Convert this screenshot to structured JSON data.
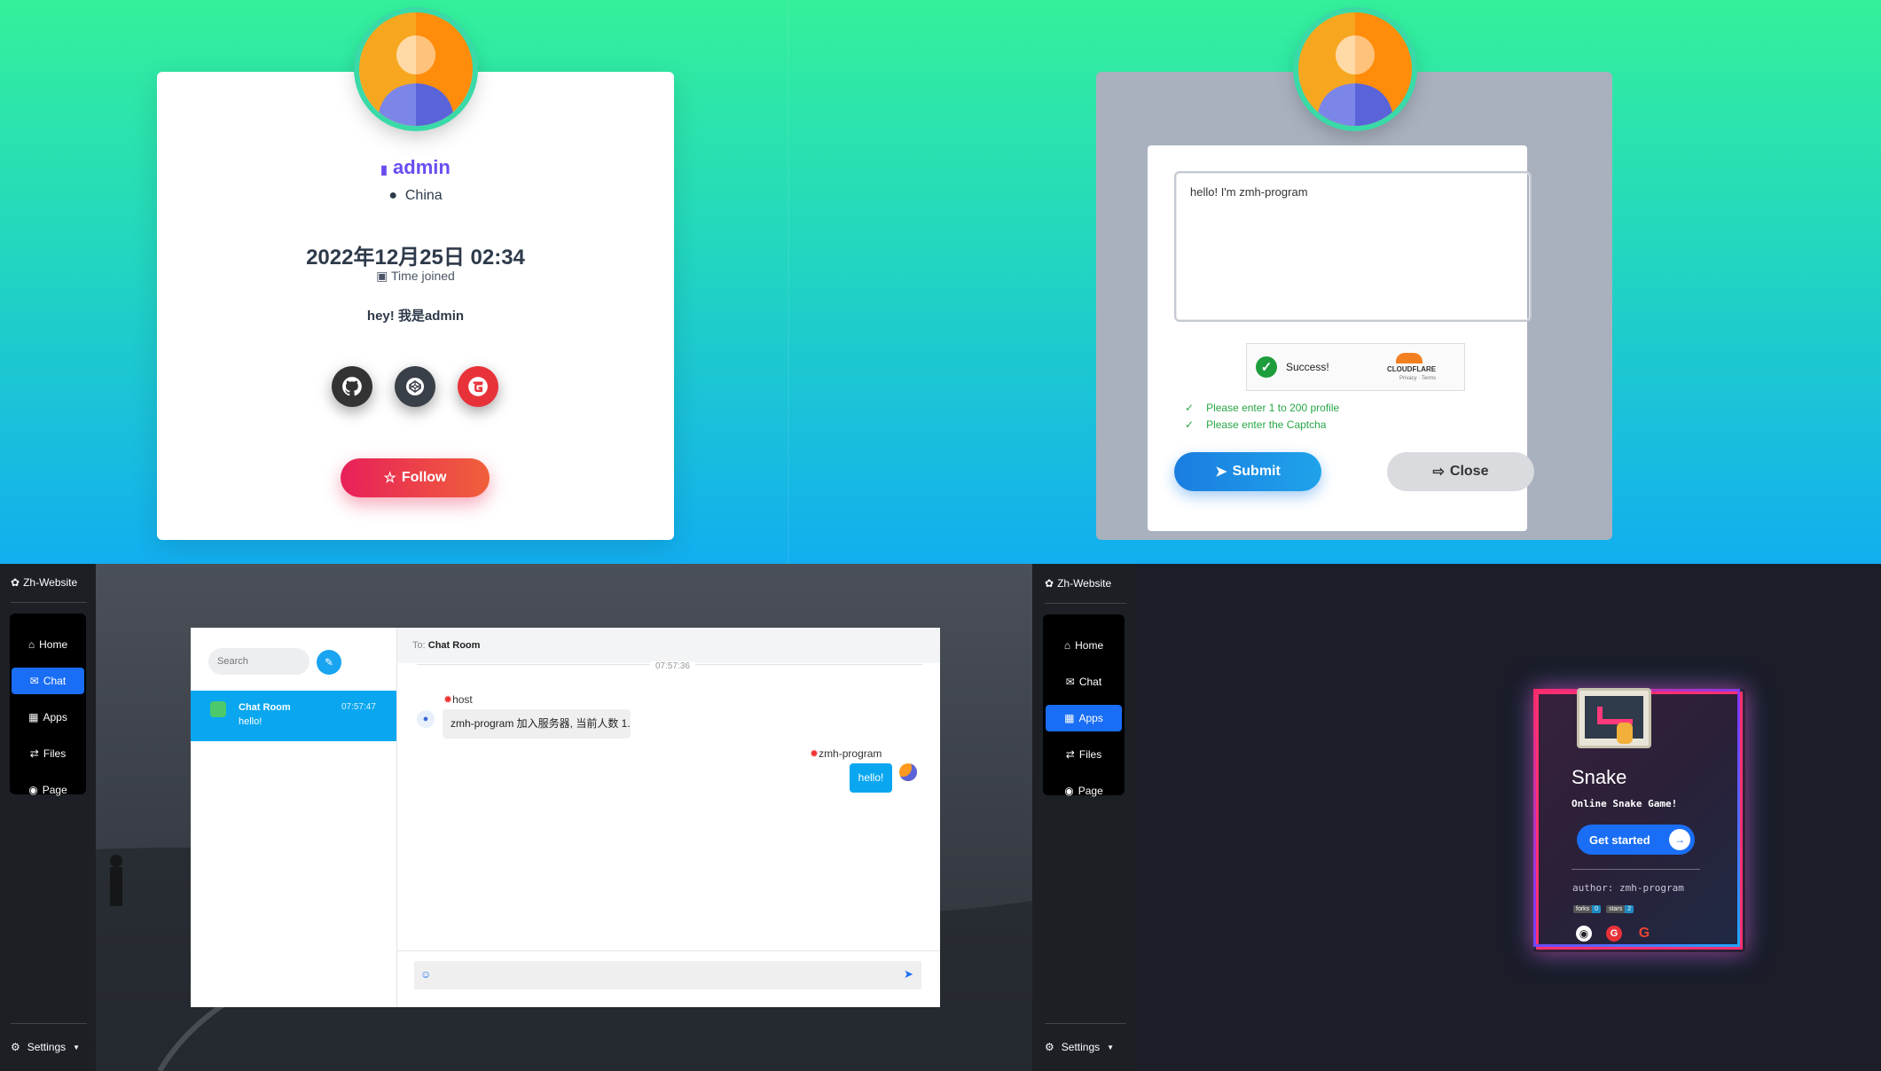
{
  "profile": {
    "name": "admin",
    "location": "China",
    "joined_date": "2022年12月25日 02:34",
    "joined_label": "Time joined",
    "bio": "hey! 我是admin",
    "follow_label": "Follow",
    "social_icons": [
      "github-icon",
      "codepen-icon",
      "gitee-icon"
    ]
  },
  "edit_form": {
    "bio_value": "hello! I'm zmh-program",
    "captcha": {
      "status": "Success!",
      "brand": "CLOUDFLARE",
      "links": "Privacy · Terms"
    },
    "validation": [
      "Please enter 1 to 200 profile",
      "Please enter the Captcha"
    ],
    "submit_label": "Submit",
    "close_label": "Close"
  },
  "chat_app": {
    "brand": "Zh-Website",
    "nav": [
      "Home",
      "Chat",
      "Apps",
      "Files",
      "Page"
    ],
    "active_nav": "Chat",
    "settings_label": "Settings",
    "search_placeholder": "Search",
    "conversation": {
      "name": "Chat Room",
      "time": "07:57:47",
      "preview": "hello!"
    },
    "header_to": "To:",
    "header_room": "Chat Room",
    "divider_time": "07:57:36",
    "messages": [
      {
        "user": "host",
        "text": "zmh-program 加入服务器, 当前人数 1."
      },
      {
        "user": "zmh-program",
        "text": "hello!"
      }
    ]
  },
  "apps_app": {
    "brand": "Zh-Website",
    "nav": [
      "Home",
      "Chat",
      "Apps",
      "Files",
      "Page"
    ],
    "active_nav": "Apps",
    "settings_label": "Settings",
    "snake": {
      "title": "Snake",
      "subtitle": "Online Snake Game!",
      "button": "Get started",
      "author": "author: zmh-program",
      "badges": [
        {
          "label": "forks",
          "value": "0"
        },
        {
          "label": "stars",
          "value": "2"
        }
      ]
    }
  },
  "colors": {
    "accent": "#1a6ef5",
    "chat_active": "#0aa7f0",
    "follow": "#e8205a"
  }
}
